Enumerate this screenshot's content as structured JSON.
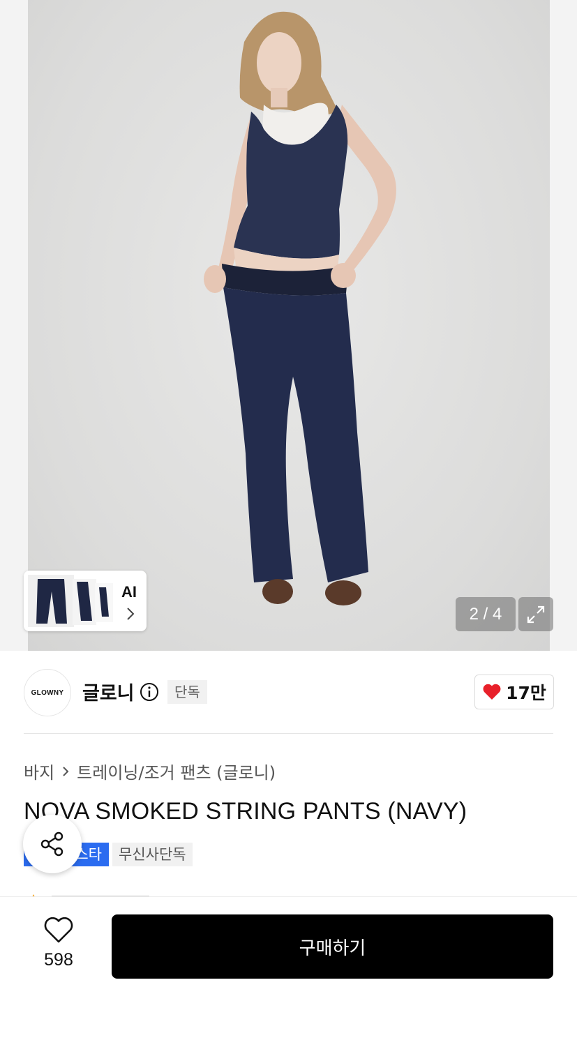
{
  "gallery": {
    "counter": "2 / 4",
    "ai_label": "AI"
  },
  "brand": {
    "logo_text": "GLOWNY",
    "name": "글로니",
    "exclusive_tag": "단독",
    "likes": "17만"
  },
  "product": {
    "breadcrumb": [
      "바지",
      "트레이닝/조거 팬츠 (글로니)"
    ],
    "title": "NOVA SMOKED STRING PANTS (NAVY)",
    "tag_blue": "스타",
    "tag_gray": "무신사단독"
  },
  "bottom_bar": {
    "wishlist_count": "598",
    "buy_label": "구매하기"
  },
  "colors": {
    "accent_blue": "#2b6cf0",
    "heart_red": "#e8202a",
    "buy_bg": "#000000"
  },
  "icons": [
    "info-icon",
    "heart-icon",
    "share-icon",
    "expand-icon",
    "chevron-right-icon"
  ]
}
